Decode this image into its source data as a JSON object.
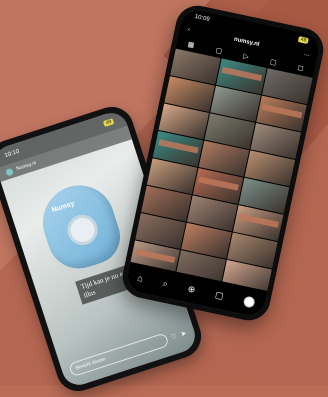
{
  "left_phone": {
    "time": "10:10",
    "battery": "49",
    "account": "Numsy.nl",
    "device_label": "Numsy",
    "caption": "Tijd kan je nu echt ideaal illus",
    "reply_placeholder": "Bericht sturen",
    "heart_icon": "heart-icon",
    "send_icon": "send-icon"
  },
  "right_phone": {
    "time": "10:09",
    "battery": "48",
    "account_title": "numsy.nl",
    "back_icon": "back-icon",
    "menu_icon": "more-icon",
    "tabs": [
      "grid-icon",
      "save-icon",
      "play-icon",
      "save-icon",
      "tag-icon"
    ],
    "bottom_nav": [
      "home-icon",
      "search-icon",
      "add-icon",
      "shop-icon"
    ],
    "tiles": [
      {
        "bg": "#8a7768"
      },
      {
        "bg": "#3c8a84"
      },
      {
        "bg": "#6e6a63"
      },
      {
        "bg": "#c88c63"
      },
      {
        "bg": "#8f9b8f"
      },
      {
        "bg": "#b97c5a"
      },
      {
        "bg": "#d9a98a"
      },
      {
        "bg": "#7b7d6e"
      },
      {
        "bg": "#9e8b7c"
      },
      {
        "bg": "#3a8c85"
      },
      {
        "bg": "#b07a60"
      },
      {
        "bg": "#b98e6f"
      },
      {
        "bg": "#c89d7e"
      },
      {
        "bg": "#b66a51"
      },
      {
        "bg": "#7c8f8a"
      },
      {
        "bg": "#a26d58"
      },
      {
        "bg": "#a08274"
      },
      {
        "bg": "#c79c80"
      },
      {
        "bg": "#8a6e5f"
      },
      {
        "bg": "#bf7e62"
      },
      {
        "bg": "#a9876e"
      },
      {
        "bg": "#b99a85"
      },
      {
        "bg": "#806b5f"
      },
      {
        "bg": "#d2a690"
      },
      {
        "bg": "#957d6c"
      },
      {
        "bg": "#c4a996"
      },
      {
        "bg": "#b49b88"
      },
      {
        "bg": "#7d6a5d"
      },
      {
        "bg": "#c7b09e"
      },
      {
        "bg": "#a28a79"
      }
    ]
  }
}
